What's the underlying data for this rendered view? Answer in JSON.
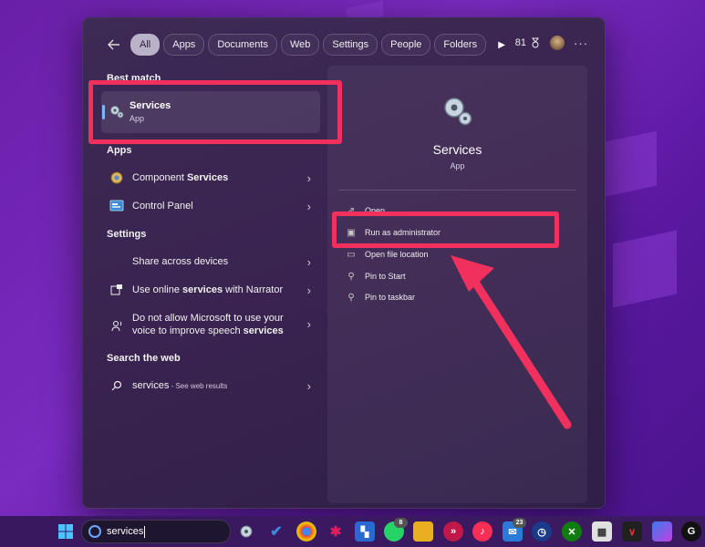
{
  "filters": {
    "back_icon": "arrow-left-icon",
    "chips": [
      "All",
      "Apps",
      "Documents",
      "Web",
      "Settings",
      "People",
      "Folders"
    ],
    "active_chip": "All",
    "points": "81",
    "more": "···"
  },
  "left": {
    "best_match_title": "Best match",
    "best_match": {
      "name": "Services",
      "type": "App"
    },
    "apps_title": "Apps",
    "apps": [
      {
        "pre": "Component ",
        "bold": "Services"
      },
      {
        "pre": "Control Panel",
        "bold": ""
      }
    ],
    "settings_title": "Settings",
    "settings": [
      {
        "pre": "Share across devices",
        "bold": ""
      },
      {
        "pre": "Use online ",
        "bold": "services",
        "post": " with Narrator"
      },
      {
        "line1": "Do not allow Microsoft to use your",
        "line2_pre": "voice to improve speech ",
        "line2_bold": "services"
      }
    ],
    "web_title": "Search the web",
    "web": {
      "query": "services",
      "hint": " - See web results"
    }
  },
  "detail": {
    "title": "Services",
    "sub": "App",
    "actions": [
      {
        "label": "Open",
        "icon": "open-icon"
      },
      {
        "label": "Run as administrator",
        "icon": "shield-icon"
      },
      {
        "label": "Open file location",
        "icon": "folder-icon"
      },
      {
        "label": "Pin to Start",
        "icon": "pin-icon"
      },
      {
        "label": "Pin to taskbar",
        "icon": "pin-icon"
      }
    ]
  },
  "taskbar": {
    "search_text": "services",
    "badges": {
      "whatsapp": "8",
      "mail": "23"
    }
  },
  "colors": {
    "highlight": "#f2305e",
    "accent": "#7fb4ff"
  }
}
